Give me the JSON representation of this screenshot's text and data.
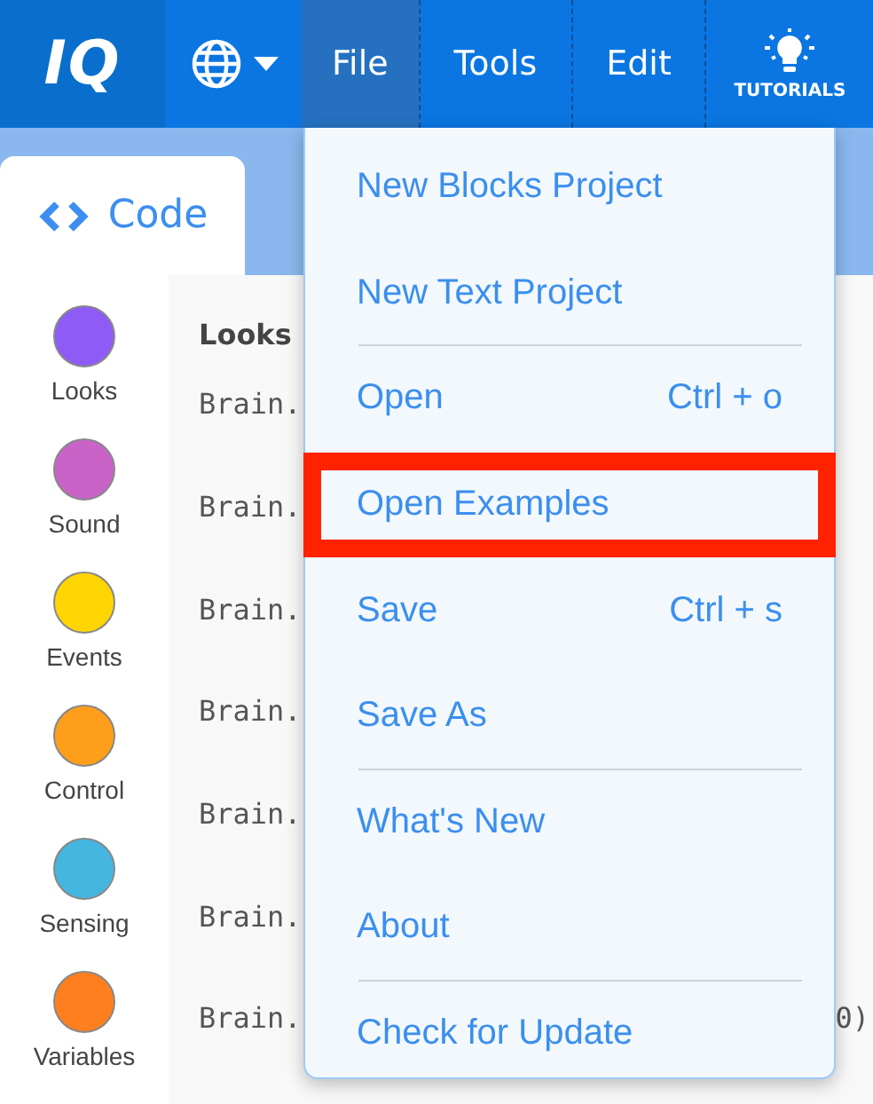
{
  "navbar": {
    "logo": "IQ",
    "menus": [
      {
        "label": "File",
        "selected": true
      },
      {
        "label": "Tools",
        "selected": false
      },
      {
        "label": "Edit",
        "selected": false
      }
    ],
    "tutorials": "TUTORIALS"
  },
  "code_tab": {
    "label": "Code"
  },
  "categories": [
    {
      "label": "Looks",
      "color": "#8f5bf7"
    },
    {
      "label": "Sound",
      "color": "#c963c7"
    },
    {
      "label": "Events",
      "color": "#ffd500"
    },
    {
      "label": "Control",
      "color": "#ff9e1b"
    },
    {
      "label": "Sensing",
      "color": "#44b6e0"
    },
    {
      "label": "Variables",
      "color": "#ff7f1f"
    }
  ],
  "code": {
    "heading": "Looks",
    "lines": [
      {
        "text": "Brain."
      },
      {
        "text": "Brain."
      },
      {
        "text": "Brain."
      },
      {
        "text": "Brain."
      },
      {
        "text": "Brain."
      },
      {
        "text": "Brain."
      },
      {
        "text": "Brain.",
        "tail": "0)"
      }
    ]
  },
  "file_menu": {
    "items": [
      {
        "kind": "item",
        "label": "New Blocks Project",
        "highlighted": false
      },
      {
        "kind": "item",
        "label": "New Text Project",
        "highlighted": false
      },
      {
        "kind": "divider"
      },
      {
        "kind": "item",
        "label": "Open",
        "shortcut": "Ctrl + o",
        "highlighted": false
      },
      {
        "kind": "item",
        "label": "Open Examples",
        "highlighted": true
      },
      {
        "kind": "item",
        "label": "Save",
        "shortcut": "Ctrl + s",
        "highlighted": false
      },
      {
        "kind": "item",
        "label": "Save As",
        "highlighted": false
      },
      {
        "kind": "divider"
      },
      {
        "kind": "item",
        "label": "What's New",
        "highlighted": false
      },
      {
        "kind": "item",
        "label": "About",
        "highlighted": false
      },
      {
        "kind": "divider"
      },
      {
        "kind": "item",
        "label": "Check for Update",
        "highlighted": false
      }
    ]
  }
}
